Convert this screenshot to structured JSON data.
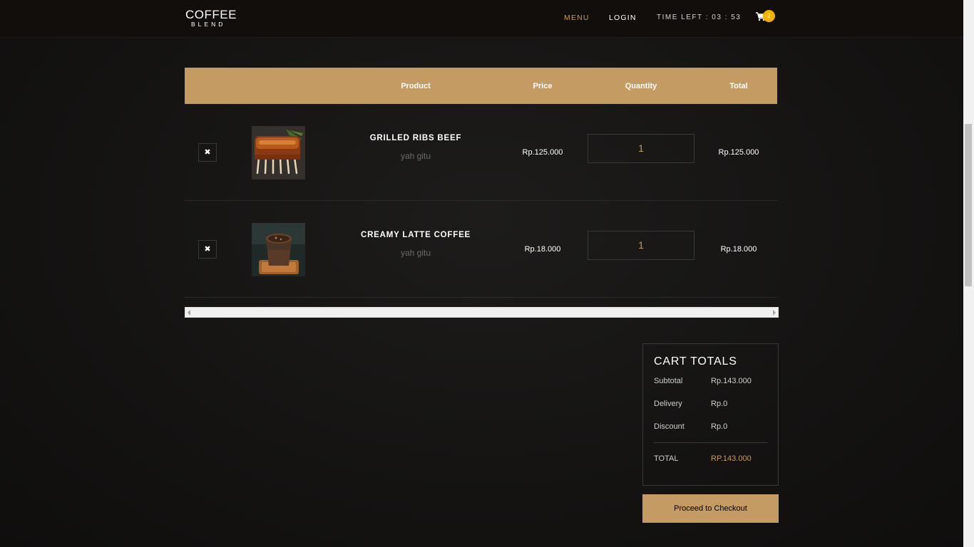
{
  "nav": {
    "brand_main": "COFFEE",
    "brand_sub": "BLEND",
    "menu": "MENU",
    "login": "LOGIN",
    "timer": "TIME LEFT : 03 : 53",
    "cart_count": "2",
    "cart_icon": "shopping-cart-icon"
  },
  "table": {
    "headers": [
      "Product",
      "Price",
      "Quantity",
      "Total"
    ],
    "rows": [
      {
        "remove": "✖",
        "name": "GRILLED RIBS BEEF",
        "desc": "yah gitu",
        "price": "Rp.125.000",
        "qty": "1",
        "total": "Rp.125.000"
      },
      {
        "remove": "✖",
        "name": "CREAMY LATTE COFFEE",
        "desc": "yah gitu",
        "price": "Rp.18.000",
        "qty": "1",
        "total": "Rp.18.000"
      }
    ]
  },
  "totals": {
    "title": "CART TOTALS",
    "subtotal_label": "Subtotal",
    "subtotal": "Rp.143.000",
    "delivery_label": "Delivery",
    "delivery": "Rp.0",
    "discount_label": "Discount",
    "discount": "Rp.0",
    "total_label": "TOTAL",
    "total": "RP.143.000"
  },
  "checkout_label": "Proceed to Checkout",
  "colors": {
    "accent": "#c49b63",
    "badge": "#f3b200",
    "bg": "#151413"
  }
}
